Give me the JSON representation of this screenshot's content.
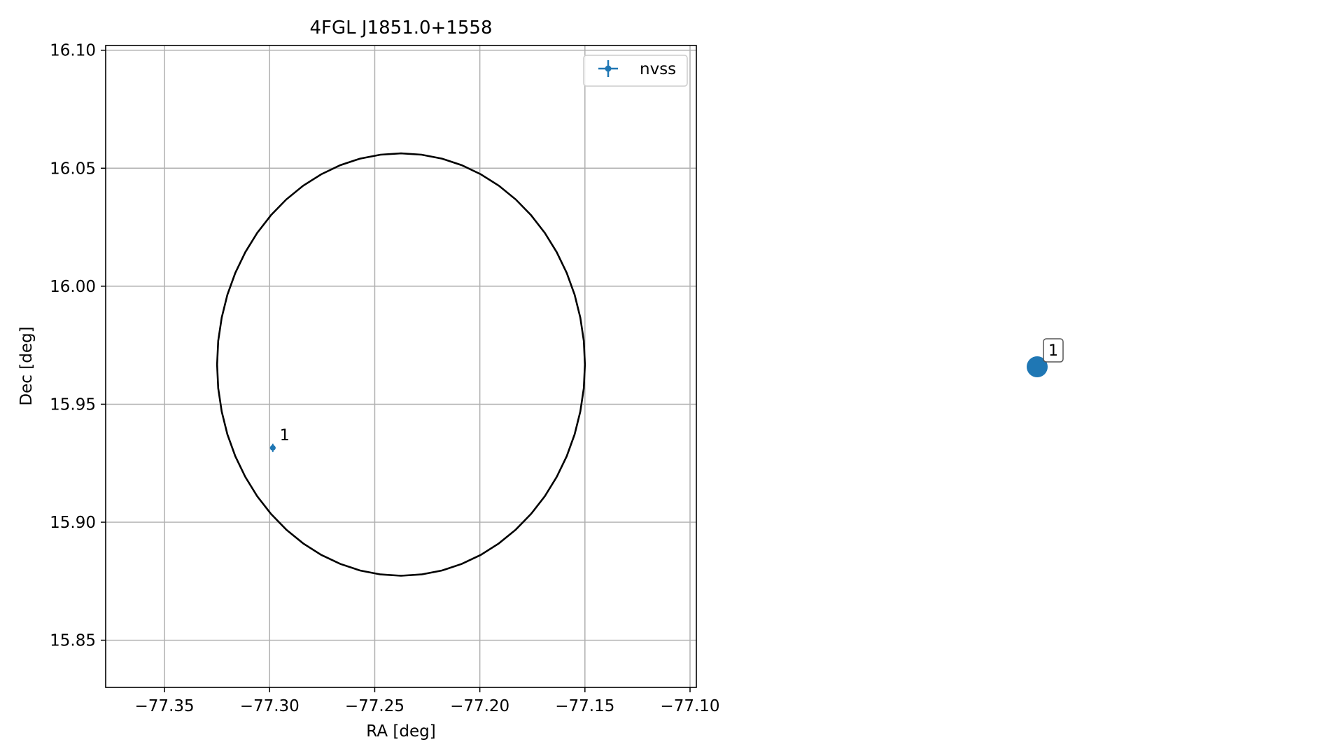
{
  "chart_data": [
    {
      "type": "scatter",
      "title": "4FGL J1851.0+1558",
      "xlabel": "RA [deg]",
      "ylabel": "Dec [deg]",
      "xlim": [
        -77.378,
        -77.097
      ],
      "ylim": [
        15.83,
        16.102
      ],
      "x_ticks": [
        -77.35,
        -77.3,
        -77.25,
        -77.2,
        -77.15,
        -77.1
      ],
      "x_tick_labels": [
        "−77.35",
        "−77.30",
        "−77.25",
        "−77.20",
        "−77.15",
        "−77.10"
      ],
      "y_ticks": [
        15.85,
        15.9,
        15.95,
        16.0,
        16.05,
        16.1
      ],
      "y_tick_labels": [
        "15.85",
        "15.90",
        "15.95",
        "16.00",
        "16.05",
        "16.10"
      ],
      "grid": true,
      "legend": {
        "placement": "top-right",
        "entries": [
          "nvss"
        ]
      },
      "series": [
        {
          "name": "nvss",
          "color": "#1f77b4",
          "marker": "errorbar-point",
          "points": [
            {
              "x": -77.2985,
              "y": 15.9315,
              "label": "1"
            }
          ]
        }
      ],
      "ellipse": {
        "color": "#000000",
        "center": {
          "x": -77.2375,
          "y": 15.9668
        },
        "semi_axis_x": 0.0875,
        "semi_axis_y": 0.0895
      }
    },
    {
      "type": "scatter",
      "title": "",
      "axes_visible": false,
      "points": [
        {
          "label": "1",
          "color": "#1f77b4"
        }
      ]
    }
  ]
}
